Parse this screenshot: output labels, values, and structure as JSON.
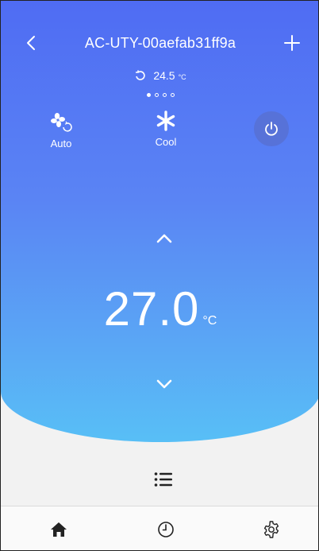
{
  "header": {
    "title": "AC-UTY-00aefab31ff9a"
  },
  "indoor": {
    "temperature": "24.5",
    "unit": "°C"
  },
  "pager": {
    "count": 4,
    "active_index": 0
  },
  "modes": {
    "fan_label": "Auto",
    "op_label": "Cool"
  },
  "setpoint": {
    "value": "27.0",
    "unit": "°C"
  },
  "colors": {
    "gradient_top": "#4f6cf3",
    "gradient_bottom": "#58bff6",
    "power_button": "#5772d8",
    "tab_icon": "#222222"
  },
  "icons": {
    "back": "chevron-left-icon",
    "add": "plus-icon",
    "indoor": "refresh-icon",
    "fan": "fan-auto-icon",
    "cool": "snowflake-icon",
    "power": "power-icon",
    "up": "chevron-up-icon",
    "down": "chevron-down-icon",
    "list": "list-icon",
    "home": "home-icon",
    "schedule": "clock-icon",
    "settings": "gear-icon"
  }
}
